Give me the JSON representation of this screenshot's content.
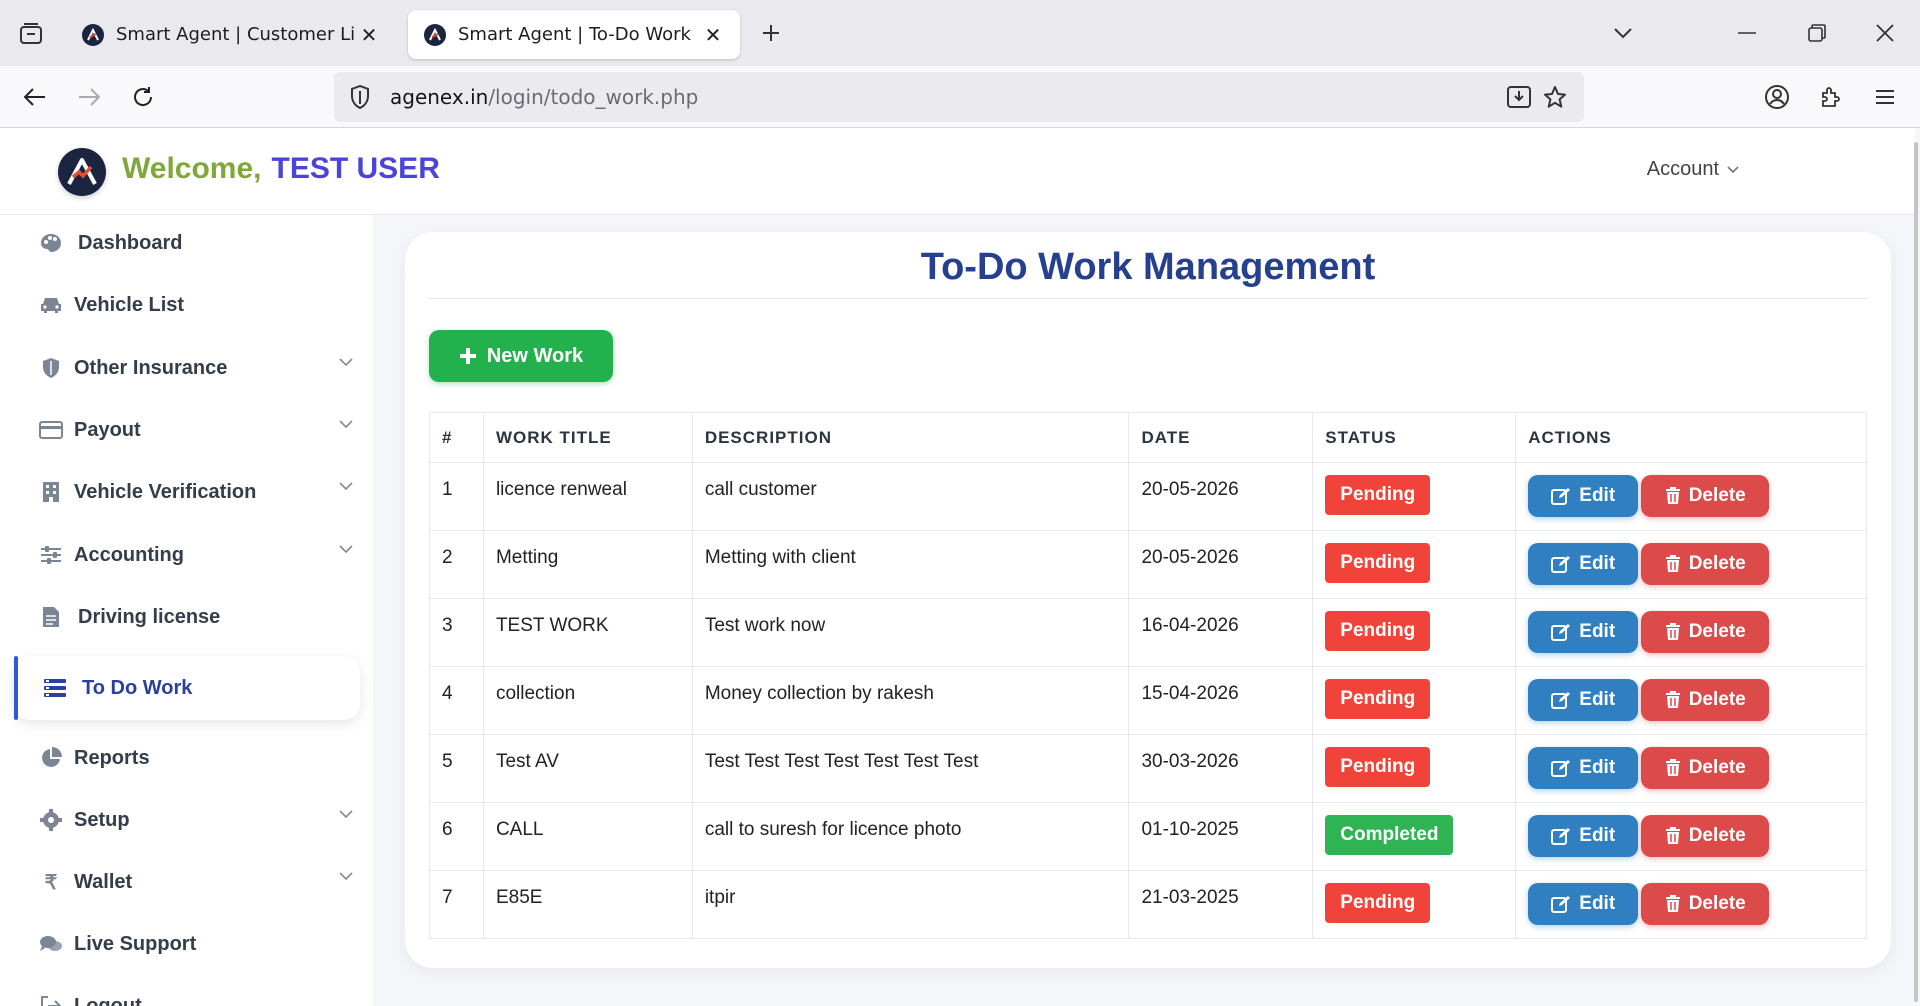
{
  "browser": {
    "tabs": [
      {
        "title": "Smart Agent | Customer List",
        "active": false
      },
      {
        "title": "Smart Agent | To-Do Work",
        "active": true
      }
    ],
    "url_domain": "agenex.in",
    "url_path": "/login/todo_work.php"
  },
  "header": {
    "welcome": "Welcome,",
    "user": "TEST USER",
    "account": "Account"
  },
  "sidebar": {
    "items": [
      {
        "label": "Dashboard",
        "icon": "palette-icon",
        "chevron": false
      },
      {
        "label": "Vehicle List",
        "icon": "car-icon",
        "chevron": false
      },
      {
        "label": "Other Insurance",
        "icon": "shield-icon",
        "chevron": true
      },
      {
        "label": "Payout",
        "icon": "credit-card-icon",
        "chevron": true
      },
      {
        "label": "Vehicle Verification",
        "icon": "building-icon",
        "chevron": true
      },
      {
        "label": "Accounting",
        "icon": "sliders-icon",
        "chevron": true
      },
      {
        "label": "Driving license",
        "icon": "document-icon",
        "chevron": false
      },
      {
        "label": "To Do Work",
        "icon": "list-icon",
        "chevron": false,
        "active": true
      },
      {
        "label": "Reports",
        "icon": "pie-chart-icon",
        "chevron": false
      },
      {
        "label": "Setup",
        "icon": "gear-icon",
        "chevron": true
      },
      {
        "label": "Wallet",
        "icon": "rupee-icon",
        "chevron": true
      },
      {
        "label": "Live Support",
        "icon": "chat-icon",
        "chevron": false
      },
      {
        "label": "Logout",
        "icon": "logout-icon",
        "chevron": false
      }
    ]
  },
  "main": {
    "title": "To-Do Work Management",
    "new_button": "New Work",
    "table": {
      "headers": [
        "#",
        "WORK TITLE",
        "DESCRIPTION",
        "DATE",
        "STATUS",
        "ACTIONS"
      ],
      "edit_label": "Edit",
      "delete_label": "Delete",
      "rows": [
        {
          "no": "1",
          "title": "licence renweal",
          "description": "call customer",
          "date": "20-05-2026",
          "status": "Pending"
        },
        {
          "no": "2",
          "title": "Metting",
          "description": "Metting with client",
          "date": "20-05-2026",
          "status": "Pending"
        },
        {
          "no": "3",
          "title": "TEST WORK",
          "description": "Test work now",
          "date": "16-04-2026",
          "status": "Pending"
        },
        {
          "no": "4",
          "title": "collection",
          "description": "Money collection by rakesh",
          "date": "15-04-2026",
          "status": "Pending"
        },
        {
          "no": "5",
          "title": "Test AV",
          "description": "Test Test Test Test Test Test Test",
          "date": "30-03-2026",
          "status": "Pending"
        },
        {
          "no": "6",
          "title": "CALL",
          "description": "call to suresh for licence photo",
          "date": "01-10-2025",
          "status": "Completed"
        },
        {
          "no": "7",
          "title": "E85E",
          "description": "itpir",
          "date": "21-03-2025",
          "status": "Pending"
        }
      ]
    }
  },
  "colors": {
    "title_blue": "#25408f",
    "pending": "#f0443a",
    "completed": "#2fb454",
    "edit": "#2f7fc1",
    "delete": "#dc4a4a",
    "new_work": "#22b14c"
  }
}
